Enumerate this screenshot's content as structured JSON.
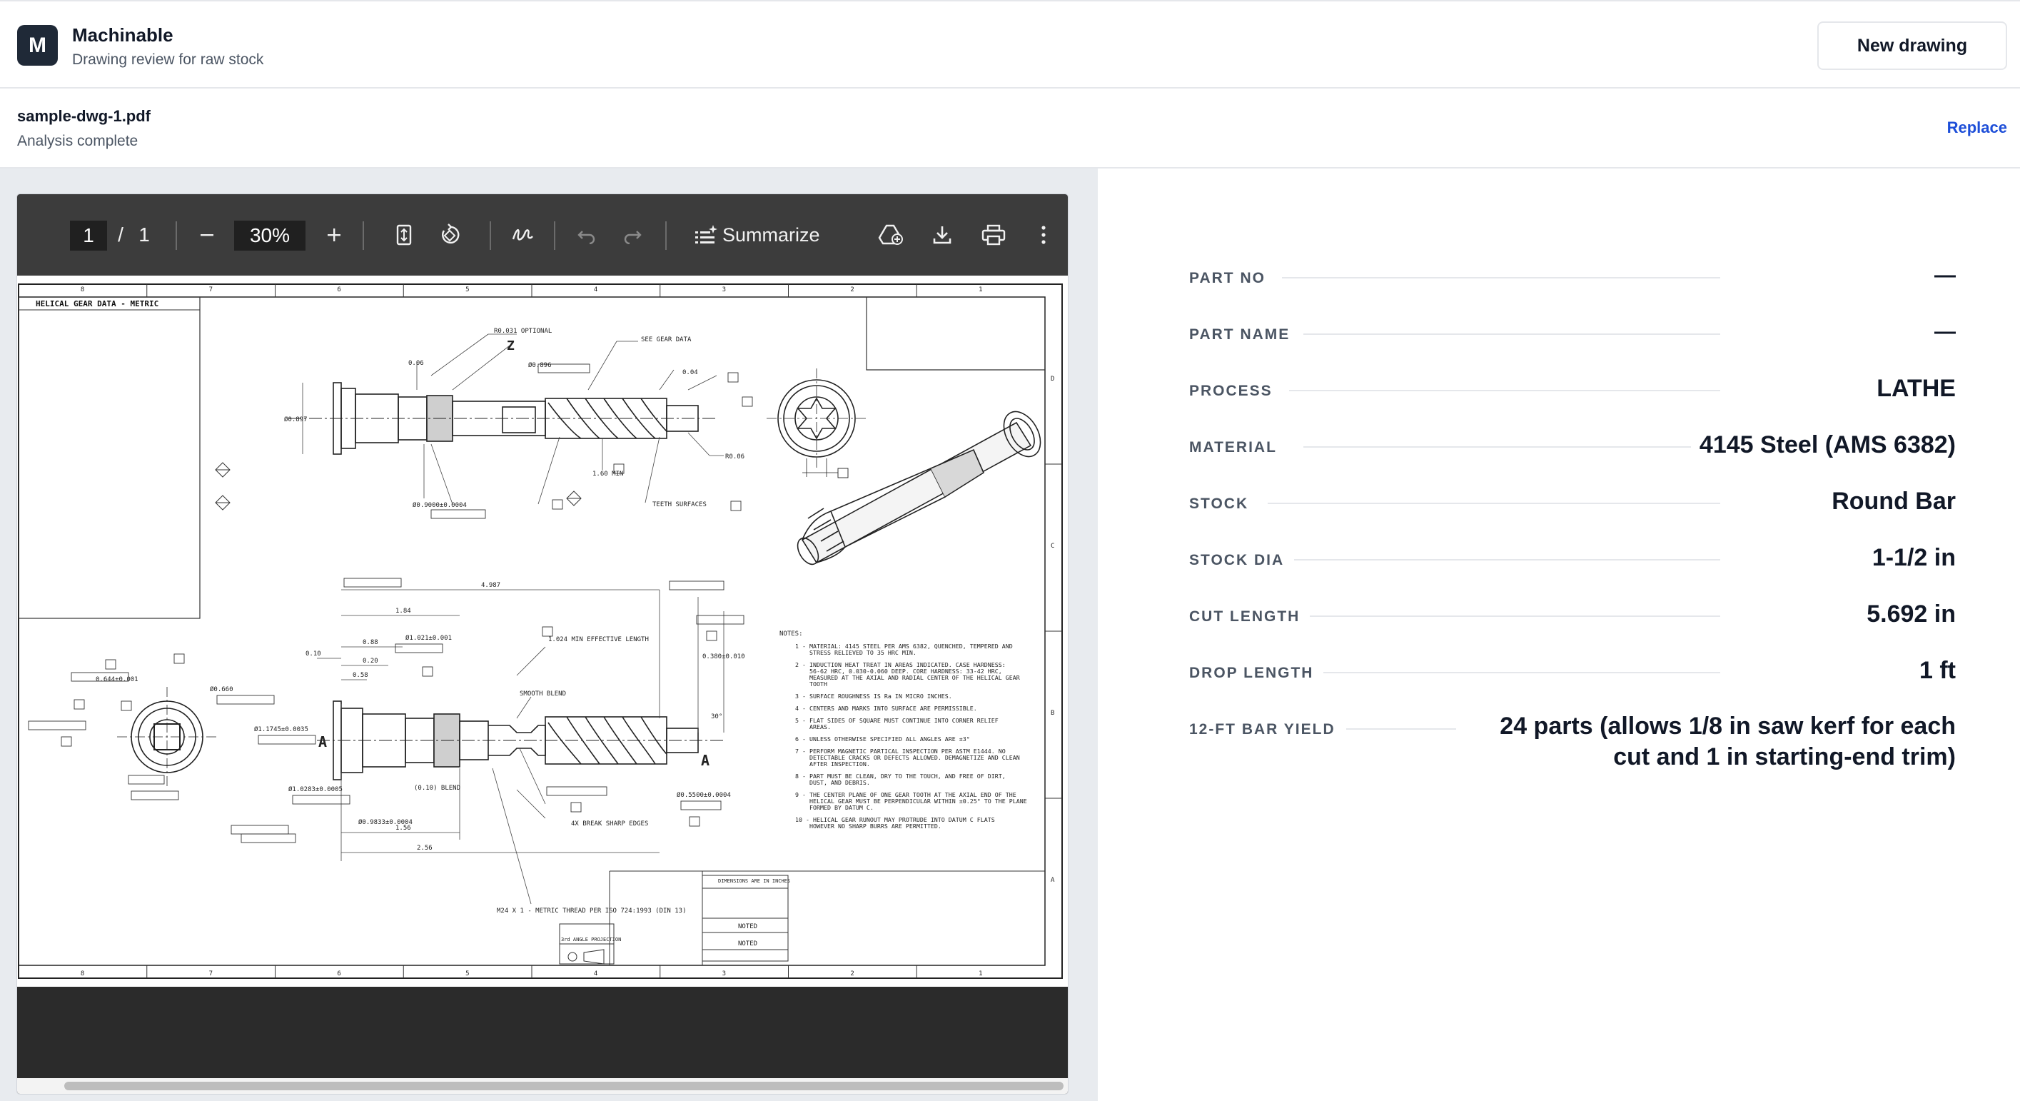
{
  "app": {
    "logo_letter": "M",
    "title": "Machinable",
    "subtitle": "Drawing review for raw stock",
    "new_button": "New drawing"
  },
  "file": {
    "name": "sample-dwg-1.pdf",
    "status": "Analysis complete",
    "replace_label": "Replace"
  },
  "pdf_toolbar": {
    "page_current": "1",
    "page_separator": "/",
    "page_total": "1",
    "zoom": "30%",
    "summarize_label": "Summarize",
    "icons": [
      "menu-icon",
      "zoom-out-icon",
      "zoom-in-icon",
      "fit-page-icon",
      "rotate-icon",
      "draw-icon",
      "undo-icon",
      "redo-icon",
      "summarize-icon",
      "save-to-drive-icon",
      "download-icon",
      "print-icon",
      "more-icon"
    ]
  },
  "drawing": {
    "table_title": "HELICAL GEAR DATA - METRIC",
    "zone_numbers": [
      "8",
      "7",
      "6",
      "5",
      "4",
      "3",
      "2",
      "1"
    ],
    "zone_letters": [
      "D",
      "C",
      "B",
      "A"
    ],
    "callouts": {
      "r031": "R0.031 OPTIONAL",
      "z": "Z",
      "see_gear": "SEE GEAR DATA",
      "d897": "Ø0.897",
      "d896": "Ø0.896",
      "d06": "0.06",
      "d04": "0.04",
      "r06": "R0.06",
      "min160": "1.60 MIN",
      "teeth": "TEETH SURFACES",
      "d9000": "Ø0.9000±0.0004",
      "len4987": "4.987",
      "len184": "1.84",
      "len088": "0.88",
      "len020": "0.20",
      "len058": "0.58",
      "len010": "0.10",
      "eff_len": "1.024 MIN EFFECTIVE LENGTH",
      "smooth_blend": "SMOOTH BLEND",
      "d1021": "Ø1.021±0.001",
      "d1174": "Ø1.1745±0.0035",
      "d1028": "Ø1.0283±0.0005",
      "d9833": "Ø0.9833±0.0004",
      "len156": "1.56",
      "len256": "2.56",
      "blend": "(0.10) BLEND",
      "break_edges": "4X BREAK SHARP EDGES",
      "thread": "M24 X 1 - METRIC THREAD PER ISO 724:1993 (DIN 13)",
      "d5500": "Ø0.5500±0.0004",
      "d380": "0.380±0.010",
      "d660": "Ø0.660",
      "d644": "0.644±0.001",
      "section_a": "A",
      "angle": "30°",
      "proj": "3rd ANGLE PROJECTION"
    },
    "notes_title": "NOTES:",
    "notes": [
      "1 - MATERIAL: 4145 STEEL PER AMS 6382, QUENCHED, TEMPERED AND STRESS RELIEVED TO 35 HRC MIN.",
      "2 - INDUCTION HEAT TREAT IN AREAS INDICATED. CASE HARDNESS: 56-62 HRC, 0.030-0.060 DEEP. CORE HARDNESS: 33-42 HRC, MEASURED AT THE AXIAL AND RADIAL CENTER OF THE HELICAL GEAR TOOTH",
      "3 - SURFACE ROUGHNESS IS Ra IN MICRO INCHES.",
      "4 - CENTERS AND MARKS INTO SURFACE ARE PERMISSIBLE.",
      "5 - FLAT SIDES OF SQUARE MUST CONTINUE INTO CORNER RELIEF AREAS.",
      "6 - UNLESS OTHERWISE SPECIFIED ALL ANGLES ARE ±3°",
      "7 - PERFORM MAGNETIC PARTICAL INSPECTION PER ASTM E1444. NO DETECTABLE CRACKS OR DEFECTS ALLOWED. DEMAGNETIZE AND CLEAN AFTER INSPECTION.",
      "8 - PART MUST BE CLEAN, DRY TO THE TOUCH, AND FREE OF DIRT, DUST, AND DEBRIS.",
      "9 - THE CENTER PLANE OF ONE GEAR TOOTH AT THE AXIAL END OF THE HELICAL GEAR MUST BE PERPENDICULAR WITHIN ±0.25° TO THE PLANE FORMED BY DATUM C.",
      "10 - HELICAL GEAR RUNOUT MAY PROTRUDE INTO DATUM C FLATS HOWEVER NO SHARP BURRS ARE PERMITTED."
    ],
    "title_block": {
      "dims_note": "DIMENSIONS ARE IN INCHES",
      "material_value": "NOTED",
      "heat_treat_value": "NOTED"
    }
  },
  "results": {
    "rows": [
      {
        "label": "PART NO",
        "value": "—"
      },
      {
        "label": "PART NAME",
        "value": "—"
      },
      {
        "label": "PROCESS",
        "value": "LATHE"
      },
      {
        "label": "MATERIAL",
        "value": "4145 Steel (AMS 6382)"
      },
      {
        "label": "STOCK",
        "value": "Round Bar"
      },
      {
        "label": "STOCK DIA",
        "value": "1-1/2 in"
      },
      {
        "label": "CUT LENGTH",
        "value": "5.692 in"
      },
      {
        "label": "DROP LENGTH",
        "value": "1 ft"
      },
      {
        "label": "12-FT BAR YIELD",
        "value": "24 parts (allows 1/8 in saw kerf for each cut and 1 in starting-end trim)"
      }
    ]
  }
}
